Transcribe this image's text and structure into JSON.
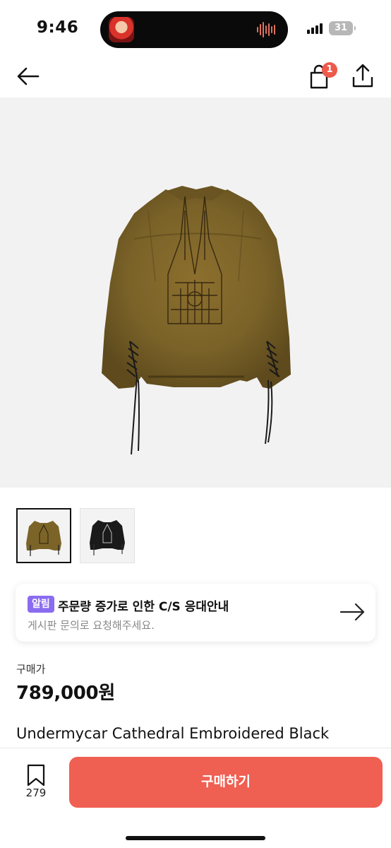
{
  "status_bar": {
    "time": "9:46",
    "battery": "31"
  },
  "nav": {
    "back_icon": "arrow-left-icon",
    "cart_icon": "shopping-bag-icon",
    "cart_badge": "1",
    "share_icon": "share-upload-icon"
  },
  "product": {
    "hero_image": "tan suede jacket with embroidered cathedral on back, laced sleeves",
    "thumbnails": [
      {
        "alt": "tan suede jacket",
        "selected": true
      },
      {
        "alt": "black jacket",
        "selected": false
      }
    ]
  },
  "notice": {
    "tag": "알림",
    "title": "주문량 증가로 인한 C/S 응대안내",
    "subtitle": "게시판 문의로 요청해주세요.",
    "arrow_icon": "arrow-right-icon"
  },
  "price": {
    "label": "구매가",
    "value": "789,000원"
  },
  "title": "Undermycar Cathedral Embroidered Black",
  "bottom_bar": {
    "save_icon": "bookmark-icon",
    "save_count": "279",
    "buy_label": "구매하기"
  },
  "colors": {
    "accent": "#ef5f52",
    "badge": "#ec5a4c",
    "tag": "#8a6cf0"
  }
}
